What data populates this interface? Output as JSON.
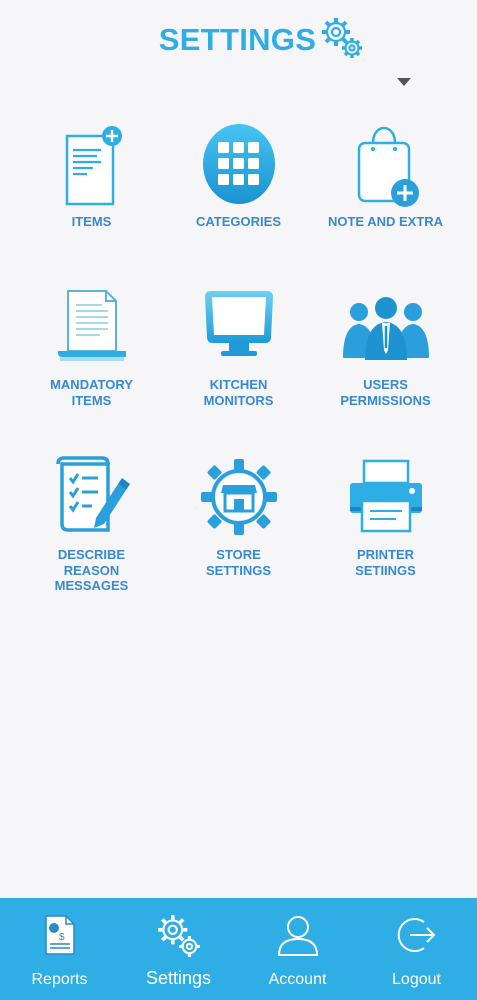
{
  "header": {
    "title": "SETTINGS"
  },
  "colors": {
    "accent": "#2eaee4",
    "label": "#3889d2",
    "background": "#f6f6f9"
  },
  "tiles": [
    {
      "label": "ITEMS",
      "icon": "document-add-icon"
    },
    {
      "label": "CATEGORIES",
      "icon": "grid-icon"
    },
    {
      "label": "NOTE AND EXTRA",
      "icon": "shopping-bag-add-icon"
    },
    {
      "label": "MANDATORY\nITEMS",
      "icon": "book-icon"
    },
    {
      "label": "KITCHEN\nMONITORS",
      "icon": "monitor-icon"
    },
    {
      "label": "USERS\nPERMISSIONS",
      "icon": "users-icon"
    },
    {
      "label": "DESCRIBE\nREASON\nMESSAGES",
      "icon": "checklist-pen-icon"
    },
    {
      "label": "STORE\nSETTINGS",
      "icon": "store-gear-icon"
    },
    {
      "label": "PRINTER\nSETIINGS",
      "icon": "printer-icon"
    }
  ],
  "tabbar": {
    "tabs": [
      {
        "label": "Reports",
        "icon": "report-icon"
      },
      {
        "label": "Settings",
        "icon": "gears-icon",
        "active": true
      },
      {
        "label": "Account",
        "icon": "user-icon"
      },
      {
        "label": "Logout",
        "icon": "logout-icon"
      }
    ]
  }
}
